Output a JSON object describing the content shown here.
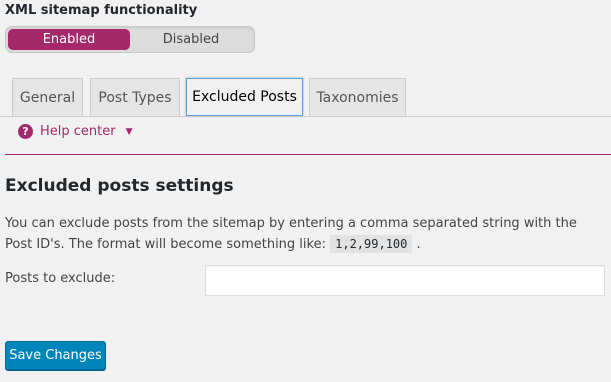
{
  "toggle": {
    "title": "XML sitemap functionality",
    "options": [
      "Enabled",
      "Disabled"
    ],
    "selected": "Enabled"
  },
  "tabs": [
    {
      "label": "General"
    },
    {
      "label": "Post Types"
    },
    {
      "label": "Excluded Posts",
      "active": true
    },
    {
      "label": "Taxonomies"
    }
  ],
  "help": {
    "label": "Help center",
    "icon": "question-circle-icon"
  },
  "section": {
    "title": "Excluded posts settings",
    "desc_text": "You can exclude posts from the sitemap by entering a comma separated string with the Post ID's. The format will become something like:",
    "desc_code": "1,2,99,100",
    "desc_end": "."
  },
  "field": {
    "label": "Posts to exclude:",
    "value": ""
  },
  "actions": {
    "save_label": "Save Changes"
  },
  "colors": {
    "accent": "#a4286a",
    "primary_button": "#0085ba"
  }
}
